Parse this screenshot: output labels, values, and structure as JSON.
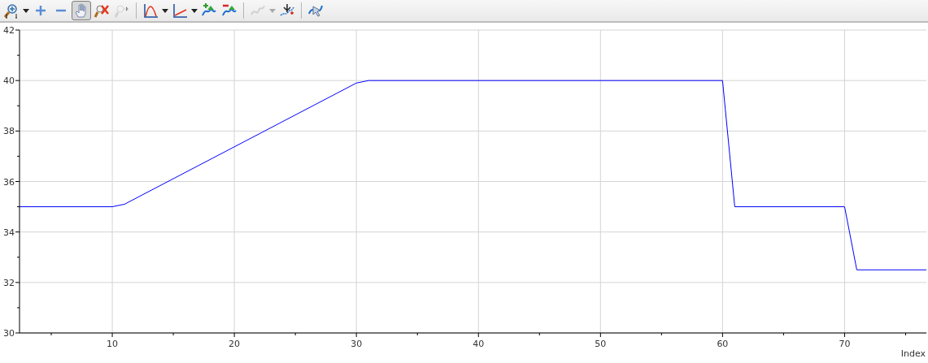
{
  "toolbar": {
    "groups": [
      [
        {
          "kind": "zoom",
          "dropdown": true,
          "selected": false,
          "disabled": false
        },
        {
          "kind": "plus",
          "dropdown": false,
          "selected": false,
          "disabled": false
        },
        {
          "kind": "minus",
          "dropdown": false,
          "selected": false,
          "disabled": false
        },
        {
          "kind": "pan",
          "dropdown": false,
          "selected": true,
          "disabled": false
        },
        {
          "kind": "reset",
          "dropdown": false,
          "selected": false,
          "disabled": false
        },
        {
          "kind": "fit",
          "dropdown": false,
          "selected": false,
          "disabled": true
        }
      ],
      [
        {
          "kind": "curve",
          "dropdown": true,
          "selected": false,
          "disabled": false
        },
        {
          "kind": "axes",
          "dropdown": true,
          "selected": false,
          "disabled": false
        },
        {
          "kind": "add",
          "dropdown": false,
          "selected": false,
          "disabled": false
        },
        {
          "kind": "remove",
          "dropdown": false,
          "selected": false,
          "disabled": false
        }
      ],
      [
        {
          "kind": "style",
          "dropdown": true,
          "selected": false,
          "disabled": true
        },
        {
          "kind": "marker",
          "dropdown": false,
          "selected": false,
          "disabled": false
        }
      ],
      [
        {
          "kind": "cursor",
          "dropdown": false,
          "selected": false,
          "disabled": false
        }
      ]
    ]
  },
  "plot": {
    "chart_data": {
      "type": "line",
      "xlabel": "Index",
      "x": [
        2.4,
        10,
        11,
        30,
        31,
        60,
        61,
        70,
        71,
        76.7
      ],
      "grid": true,
      "series": [
        {
          "color": "#0000ff",
          "values": [
            35,
            35,
            35.1,
            39.9,
            40,
            40,
            35,
            35,
            32.5,
            32.5
          ]
        }
      ],
      "xlim": [
        2.4,
        76.7
      ],
      "ylim": [
        30,
        42
      ],
      "xticks": [
        10,
        20,
        30,
        40,
        50,
        60,
        70
      ],
      "yticks": [
        30,
        32,
        34,
        36,
        38,
        40,
        42
      ]
    }
  }
}
